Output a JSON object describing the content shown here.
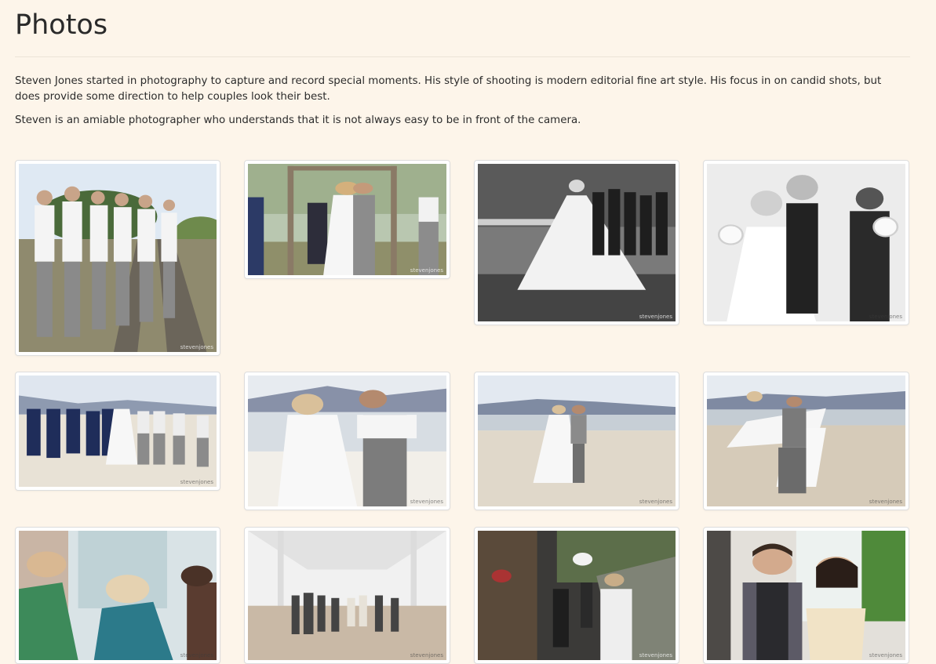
{
  "page": {
    "title": "Photos",
    "intro": [
      "Steven Jones started in photography to capture and record special moments. His style of shooting is modern editorial fine art style. His focus in on candid shots, but does provide some direction to help couples look their best.",
      "Steven is an amiable photographer who understands that it is not always easy to be in front of the camera."
    ]
  },
  "gallery": {
    "watermark": "stevenjones",
    "photos": [
      {
        "subject": "groomsmen on railway tracks"
      },
      {
        "subject": "couple kissing under floral arch"
      },
      {
        "subject": "bride with bridesmaids black and white"
      },
      {
        "subject": "bride and bridesmaids on sand black and white"
      },
      {
        "subject": "wedding party on beach"
      },
      {
        "subject": "couple embracing on beach"
      },
      {
        "subject": "couple walking on beach"
      },
      {
        "subject": "groom carrying bride on beach"
      },
      {
        "subject": "bride getting makeup done"
      },
      {
        "subject": "guests in reception hall"
      },
      {
        "subject": "bride with guests outside venue"
      },
      {
        "subject": "couple portrait by window"
      }
    ]
  },
  "colors": {
    "background": "#fdf5ea",
    "divider": "#ece4d8",
    "text": "#2b2b2b"
  }
}
